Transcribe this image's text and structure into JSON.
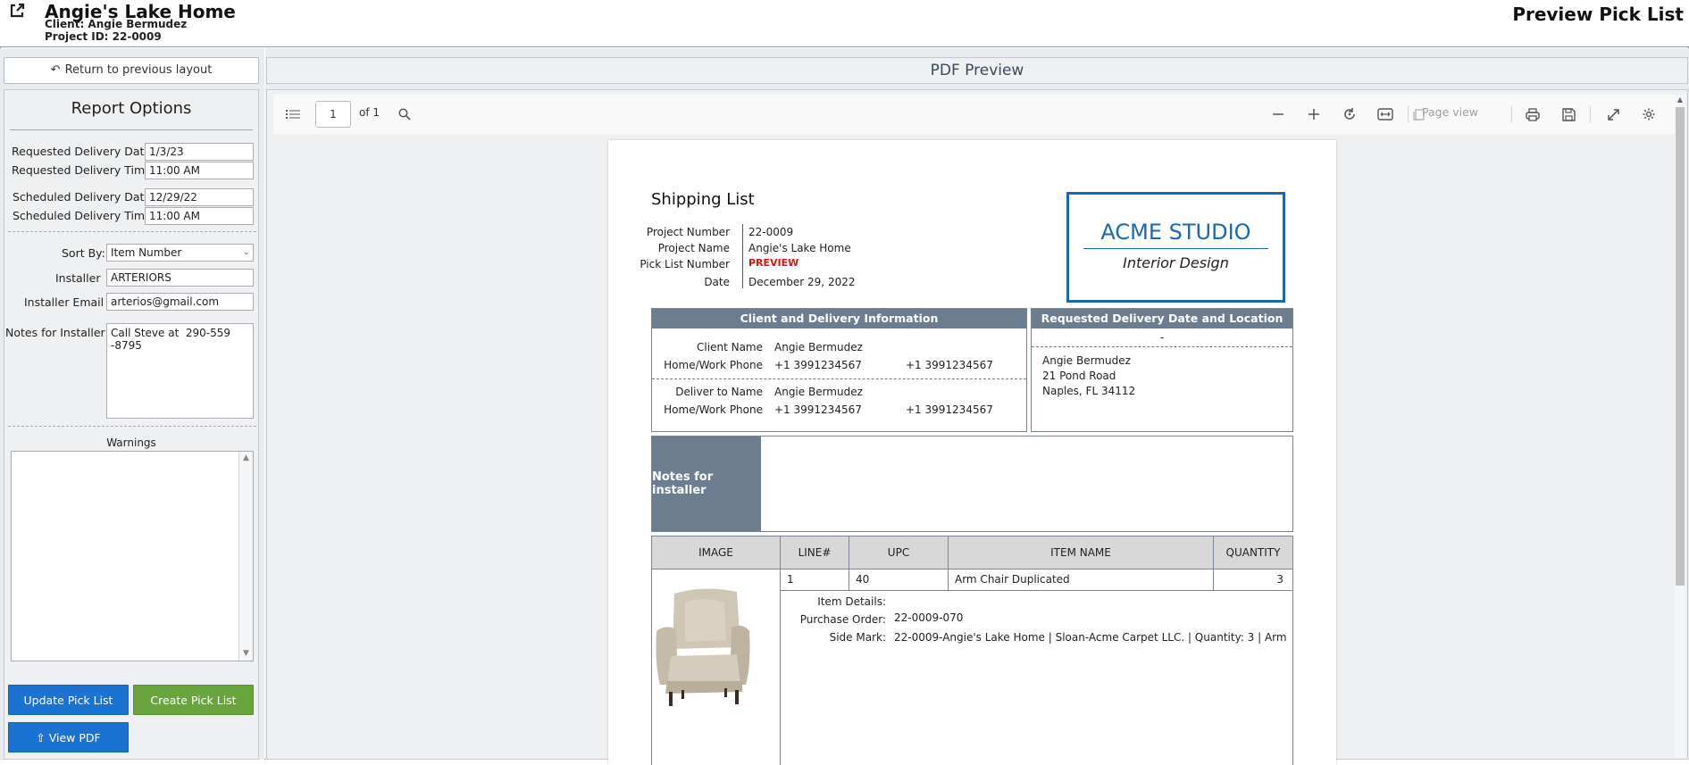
{
  "header": {
    "title": "Angie's Lake Home",
    "client": "Client: Angie Bermudez",
    "project_id": "Project ID: 22-0009",
    "right_title": "Preview Pick List",
    "icons": {
      "external": "external-link-icon"
    }
  },
  "left": {
    "return_label": "Return to previous layout",
    "report_options_title": "Report Options",
    "fields": {
      "req_date_label": "Requested Delivery Date",
      "req_date_value": "1/3/23",
      "req_time_label": "Requested Delivery Time",
      "req_time_value": "11:00 AM",
      "sched_date_label": "Scheduled Delivery Date",
      "sched_date_value": "12/29/22",
      "sched_time_label": "Scheduled Delivery Time",
      "sched_time_value": "11:00 AM",
      "sort_label": "Sort By:",
      "sort_value": "Item Number",
      "installer_label": "Installer",
      "installer_value": "ARTERIORS",
      "email_label": "Installer Email",
      "email_value": "arterios@gmail.com",
      "notes_label": "Notes for Installer",
      "notes_value": "Call Steve at  290-559\n-8795"
    },
    "warnings_label": "Warnings",
    "buttons": {
      "update": "Update Pick List",
      "create": "Create Pick List",
      "view_pdf": "View PDF"
    }
  },
  "preview": {
    "header": "PDF Preview",
    "toolbar": {
      "page_current": "1",
      "page_total": "of 1",
      "page_view": "Page view"
    },
    "doc": {
      "title": "Shipping List",
      "info": {
        "project_number_label": "Project Number",
        "project_number": "22-0009",
        "project_name_label": "Project Name",
        "project_name": "Angie's Lake Home",
        "pick_list_label": "Pick List Number",
        "pick_list": "PREVIEW",
        "date_label": "Date",
        "date": "December 29, 2022"
      },
      "logo": {
        "line1": "ACME STUDIO",
        "line2": "Interior Design"
      },
      "client_box": {
        "title": "Client and Delivery Information",
        "client_name_label": "Client Name",
        "client_name": "Angie Bermudez",
        "phone_label": "Home/Work Phone",
        "phone1": "+1 3991234567",
        "phone2": "+1 3991234567",
        "deliver_label": "Deliver to Name",
        "deliver_name": "Angie Bermudez",
        "phone_label2": "Home/Work Phone",
        "phone3": "+1 3991234567",
        "phone4": "+1 3991234567"
      },
      "delivery_box": {
        "title": "Requested Delivery Date and Location",
        "date_placeholder": "-",
        "name": "Angie Bermudez",
        "street": "21 Pond Road",
        "city": "Naples, FL 34112"
      },
      "notes_label": "Notes for installer",
      "table": {
        "headers": [
          "IMAGE",
          "LINE#",
          "UPC",
          "ITEM NAME",
          "QUANTITY"
        ],
        "rows": [
          {
            "line": "1",
            "upc": "40",
            "item_name": "Arm Chair Duplicated",
            "quantity": "3",
            "details_label": "Item Details:",
            "po_label": "Purchase Order:",
            "po": "22-0009-070",
            "sidemark_label": "Side Mark:",
            "sidemark": "22-0009-Angie's Lake Home | Sloan-Acme Carpet LLC. | Quantity: 3 | Arm"
          }
        ]
      }
    }
  }
}
